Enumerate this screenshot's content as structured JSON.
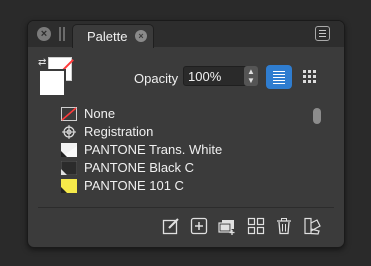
{
  "window": {
    "tab_label": "Palette"
  },
  "controls": {
    "opacity_label": "Opacity",
    "opacity_value": "100%",
    "view_mode": "list"
  },
  "swatches": [
    {
      "label": "None",
      "icon": "none-swatch-icon"
    },
    {
      "label": "Registration",
      "icon": "registration-icon"
    },
    {
      "label": "PANTONE Trans. White",
      "icon": "swatch-chip-white"
    },
    {
      "label": "PANTONE Black C",
      "icon": "swatch-chip-black"
    },
    {
      "label": "PANTONE 101 C",
      "icon": "swatch-chip-yellow"
    }
  ],
  "toolbar": [
    "edit-swatch-icon",
    "new-swatch-icon",
    "new-swatch-group-icon",
    "swatch-options-icon",
    "delete-icon",
    "swatch-library-icon"
  ],
  "colors": {
    "accent": "#2f7dd0",
    "pantone_101": "#f5e94a",
    "pantone_black": "#2b2b2b",
    "none_slash": "#ff3b3b"
  }
}
